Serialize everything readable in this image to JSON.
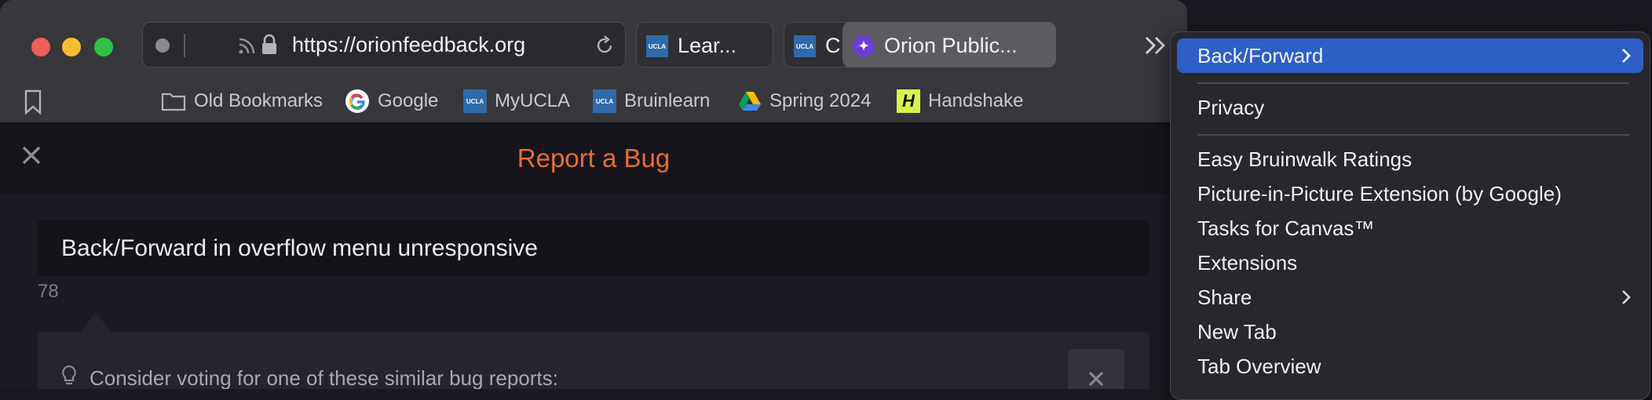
{
  "url": "https://orionfeedback.org",
  "tabs": [
    {
      "label": "Lear...",
      "favicon": "UCLA"
    },
    {
      "label": "C",
      "favicon": "UCLA"
    },
    {
      "label": "Orion Public...",
      "favicon": "✦"
    }
  ],
  "bookmarks": [
    {
      "label": "Old Bookmarks",
      "icon": "folder-icon"
    },
    {
      "label": "Google",
      "icon": "google-icon"
    },
    {
      "label": "MyUCLA",
      "icon": "UCLA"
    },
    {
      "label": "Bruinlearn",
      "icon": "UCLA"
    },
    {
      "label": "Spring 2024",
      "icon": "google-drive-icon"
    },
    {
      "label": "Handshake",
      "icon": "H"
    }
  ],
  "page": {
    "title": "Report a Bug",
    "bug_title": "Back/Forward in overflow menu unresponsive",
    "char_count": "78",
    "suggestion": "Consider voting for one of these similar bug reports:"
  },
  "menu": {
    "items": [
      {
        "label": "Back/Forward",
        "submenu": true,
        "active": true
      },
      {
        "label": "Privacy"
      },
      {
        "label": "Easy Bruinwalk Ratings"
      },
      {
        "label": "Picture-in-Picture Extension (by Google)"
      },
      {
        "label": "Tasks for Canvas™"
      },
      {
        "label": "Extensions"
      },
      {
        "label": "Share",
        "submenu": true
      },
      {
        "label": "New Tab"
      },
      {
        "label": "Tab Overview"
      }
    ]
  },
  "colors": {
    "accent": "#2e5fc6",
    "title": "#e66d34"
  }
}
